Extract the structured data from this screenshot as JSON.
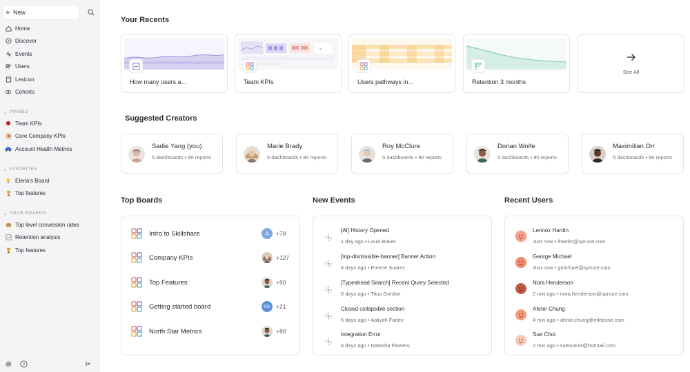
{
  "sidebar": {
    "new_label": "New",
    "search_icon": "search-icon",
    "nav": [
      {
        "label": "Home",
        "icon": "home-icon"
      },
      {
        "label": "Discover",
        "icon": "compass-icon"
      },
      {
        "label": "Events",
        "icon": "events-icon"
      },
      {
        "label": "Users",
        "icon": "users-icon"
      },
      {
        "label": "Lexicon",
        "icon": "book-icon"
      },
      {
        "label": "Cohorts",
        "icon": "cohorts-icon"
      }
    ],
    "pinned_heading": "PINNED",
    "pinned": [
      {
        "label": "Team KPIs",
        "icon": "red-circle-icon"
      },
      {
        "label": "Core Company KPIs",
        "icon": "dartboard-icon"
      },
      {
        "label": "Account Health Metrics",
        "icon": "car-icon"
      }
    ],
    "favorites_heading": "FAVORITES",
    "favorites": [
      {
        "label": "Elena's Board",
        "icon": "bulb-icon"
      },
      {
        "label": "Top features",
        "icon": "trophy-icon"
      }
    ],
    "boards_heading": "YOUR BOARDS",
    "boards": [
      {
        "label": "Top level conversion rates",
        "icon": "hamburger-icon"
      },
      {
        "label": "Retention analysis",
        "icon": "chart-icon"
      },
      {
        "label": "Top features",
        "icon": "trophy-icon"
      }
    ]
  },
  "recents": {
    "heading": "Your Recents",
    "items": [
      {
        "label": "How many users a..."
      },
      {
        "label": "Team KPIs"
      },
      {
        "label": "Users pathways in..."
      },
      {
        "label": "Retention 3 months"
      }
    ],
    "see_all": "See All"
  },
  "creators": {
    "heading": "Suggested Creators",
    "items": [
      {
        "name": "Sadie Yang (you)",
        "meta": "5 dashboards • 90 reports",
        "avatar_color": "#d9b9a8"
      },
      {
        "name": "Marie Brady",
        "meta": "5 dashboards • 90 reports",
        "avatar_color": "#c9a07a"
      },
      {
        "name": "Roy McClure",
        "meta": "5 dashboards • 90 reports",
        "avatar_color": "#b8b2aa"
      },
      {
        "name": "Dorian Wolfe",
        "meta": "5 dashboards • 90 reports",
        "avatar_color": "#6b4a36"
      },
      {
        "name": "Maximilian Orr",
        "meta": "5 dashboards • 90 reports",
        "avatar_color": "#4a3426"
      }
    ]
  },
  "top_boards": {
    "heading": "Top Boards",
    "items": [
      {
        "name": "Intro to Skillshare",
        "avatar_text": "JL",
        "avatar_color": "#7fa8e0",
        "count": "+78"
      },
      {
        "name": "Company KPIs",
        "avatar_text": "",
        "avatar_color": "#8a6a55",
        "count": "+127"
      },
      {
        "name": "Top Features",
        "avatar_text": "",
        "avatar_color": "#6b4a36",
        "count": "+90"
      },
      {
        "name": "Getting started board",
        "avatar_text": "RD",
        "avatar_color": "#5a8fd8",
        "count": "+21"
      },
      {
        "name": "North Star Metrics",
        "avatar_text": "",
        "avatar_color": "#6b4a36",
        "count": "+90"
      }
    ]
  },
  "new_events": {
    "heading": "New Events",
    "items": [
      {
        "title": "[AI] History Opened",
        "sub": "1 day ago • Louis Baker"
      },
      {
        "title": "[mp-dismissible-banner] Banner Action",
        "sub": "4 days ago • Emerie Suarez"
      },
      {
        "title": "[Typeahead Search] Recent Query Selected",
        "sub": "6 days ago • Titus Gordon"
      },
      {
        "title": "Closed collapsible section",
        "sub": "6 days ago • Aaliyah Farley"
      },
      {
        "title": "Integration Error",
        "sub": "6 days ago • Natasha Flowers"
      }
    ]
  },
  "recent_users": {
    "heading": "Recent Users",
    "items": [
      {
        "name": "Lennox Hardin",
        "sub": "Just now • lhardin@spruce.com",
        "color": "#f4a08a"
      },
      {
        "name": "George Michael",
        "sub": "Just now • gmichael@spruce.com",
        "color": "#f08a6e"
      },
      {
        "name": "Nora Henderson",
        "sub": "2 min ago • nora.henderson@spruce.com",
        "color": "#c25a48"
      },
      {
        "name": "Ahmir Chung",
        "sub": "4 min ago • ahmir.chung@mktzone.com",
        "color": "#f49a7a"
      },
      {
        "name": "Sue Choi",
        "sub": "2 min ago • suesue33@hotmail.com",
        "color": "#f6c8b8"
      }
    ]
  }
}
